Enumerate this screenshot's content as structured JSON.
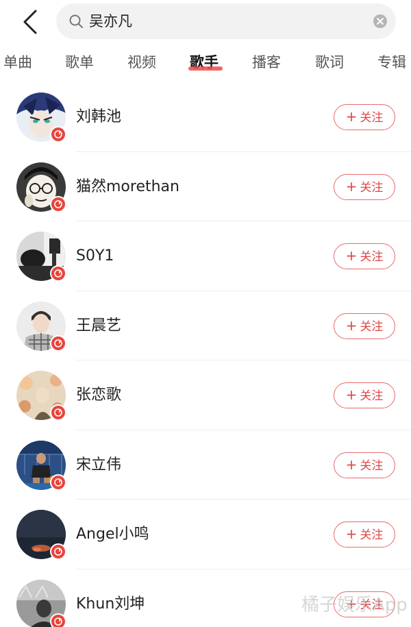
{
  "search": {
    "query": "吴亦凡"
  },
  "tabs": [
    {
      "label": "单曲"
    },
    {
      "label": "歌单"
    },
    {
      "label": "视频"
    },
    {
      "label": "歌手"
    },
    {
      "label": "播客"
    },
    {
      "label": "歌词"
    },
    {
      "label": "专辑"
    }
  ],
  "active_tab": "歌手",
  "follow_label": "关注",
  "artists": [
    {
      "name": "刘韩池",
      "avatar": "anime-illustration"
    },
    {
      "name": "猫然morethan",
      "avatar": "cartoon-face"
    },
    {
      "name": "S0Y1",
      "avatar": "dark-photo"
    },
    {
      "name": "王晨艺",
      "avatar": "person-plaid"
    },
    {
      "name": "张恋歌",
      "avatar": "floral-photo"
    },
    {
      "name": "宋立伟",
      "avatar": "basketball-court"
    },
    {
      "name": "Angel小鸣",
      "avatar": "night-sky"
    },
    {
      "name": "Khun刘坤",
      "avatar": "grey-photo"
    }
  ],
  "watermark": "橘子娱乐App",
  "colors": {
    "accent": "#e8453c",
    "follow_border": "#e86a6a",
    "search_bg": "#f2f2f2"
  }
}
